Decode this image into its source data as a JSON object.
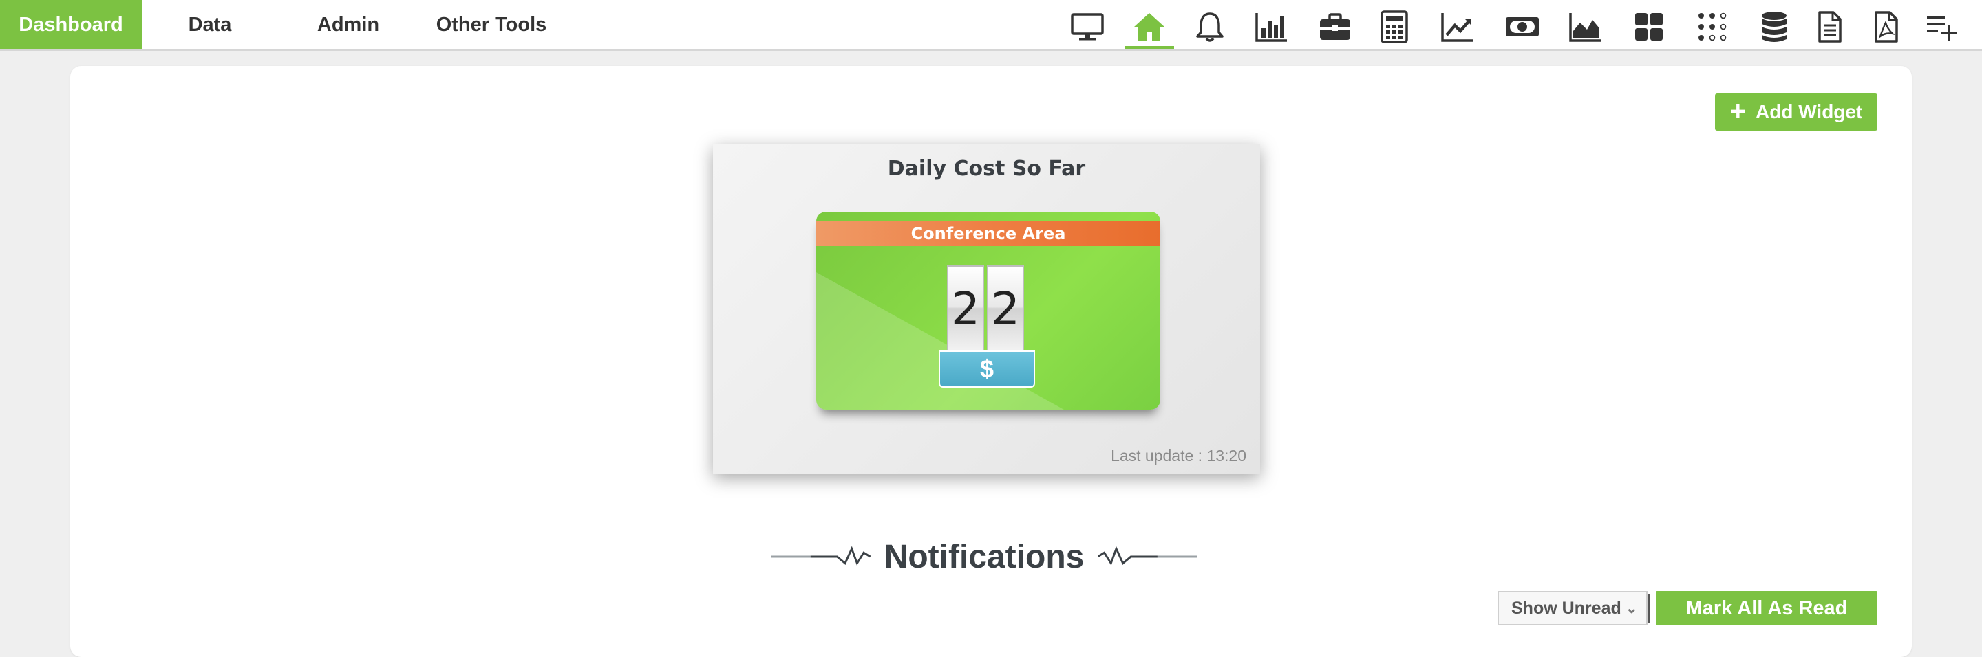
{
  "nav": {
    "tabs": [
      {
        "label": "Dashboard",
        "active": true
      },
      {
        "label": "Data"
      },
      {
        "label": "Admin"
      },
      {
        "label": "Other Tools"
      }
    ],
    "toolbar_icons": [
      "monitor-icon",
      "home-icon",
      "bell-icon",
      "bar-chart-icon",
      "briefcase-icon",
      "calculator-icon",
      "trend-line-icon",
      "money-icon",
      "area-chart-icon",
      "grid-icon",
      "dots-grid-icon",
      "database-icon",
      "document-icon",
      "pdf-icon",
      "add-list-icon"
    ],
    "active_icon": "home-icon",
    "accent_color": "#7cc242"
  },
  "toolbar": {
    "add_widget_label": "Add Widget"
  },
  "widget": {
    "title": "Daily Cost So Far",
    "area": "Conference Area",
    "digits": [
      "2",
      "2"
    ],
    "currency_symbol": "$",
    "last_update": "Last update : 13:20"
  },
  "notifications": {
    "title": "Notifications",
    "filter_selected": "Show Unread",
    "mark_all_label": "Mark All As Read"
  }
}
